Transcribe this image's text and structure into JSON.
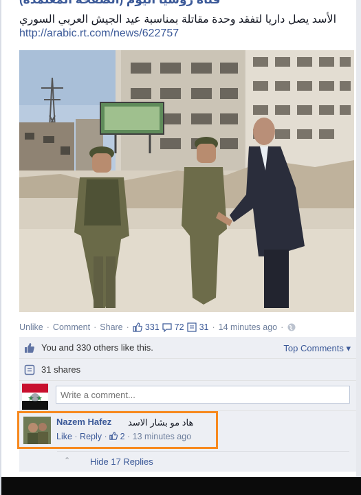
{
  "post": {
    "header_title": "قناة روسيا اليوم (الصفحة المعتمدة)",
    "text": "الأسد يصل داريا لتفقد وحدة مقاتلة بمناسبة عيد الجيش العربي السوري",
    "link": "http://arabic.rt.com/news/622757",
    "photo_icon": "photo-soldiers-and-man-handshake",
    "photo_sign_text": "",
    "actions": {
      "unlike": "Unlike",
      "comment": "Comment",
      "share": "Share",
      "likes": "331",
      "comments": "72",
      "shares": "31",
      "time": "14 minutes ago"
    }
  },
  "feedback": {
    "likes_summary": "You and 330 others like this.",
    "top_comments": "Top Comments",
    "shares_summary": "31 shares",
    "write_placeholder": "Write a comment..."
  },
  "comment": {
    "author": "Nazem Hafez",
    "text": "هاد مو بشار الاسد",
    "like": "Like",
    "reply": "Reply",
    "likes": "2",
    "time": "13 minutes ago"
  },
  "replies": {
    "label": "Hide 17 Replies"
  },
  "colors": {
    "fb_blue": "#3b5998",
    "highlight": "#f7891e",
    "feedback_bg": "#edeff4"
  }
}
